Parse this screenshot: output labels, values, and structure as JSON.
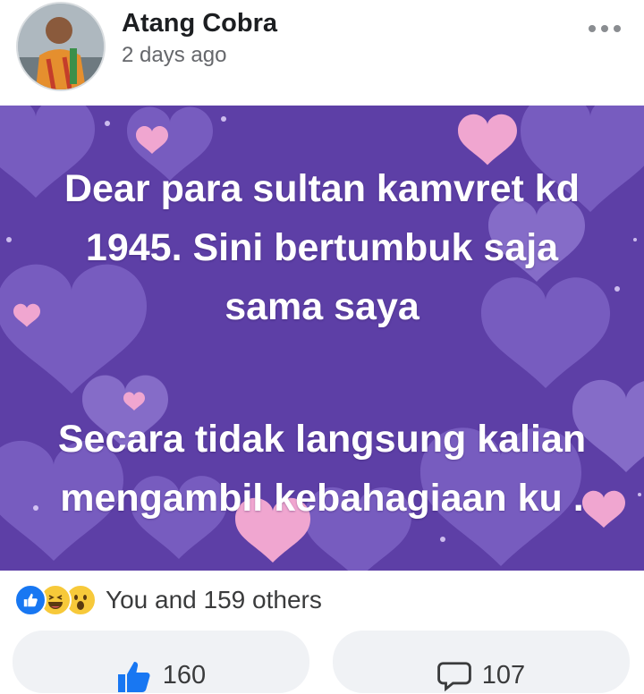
{
  "post": {
    "author": "Atang Cobra",
    "time": "2 days ago",
    "text_lines_1": [
      "Dear para sultan kamvret kd",
      "1945. Sini bertumbuk saja",
      "sama saya"
    ],
    "text_lines_2": [
      "Secara tidak langsung kalian",
      "mengambil kebahagiaan ku ."
    ],
    "background_colors": {
      "base": "#5d3fa6",
      "heart_light": "#8c72cf",
      "heart_pink": "#f0a6d0"
    }
  },
  "reactions": {
    "icons": [
      "like-icon",
      "haha-icon",
      "wow-icon"
    ],
    "summary": "You and 159 others"
  },
  "actions": {
    "like_count": "160",
    "comment_count": "107"
  },
  "colors": {
    "like_blue": "#1877f2",
    "reaction_yellow": "#f7c93a",
    "pill_bg": "#f0f2f5"
  }
}
